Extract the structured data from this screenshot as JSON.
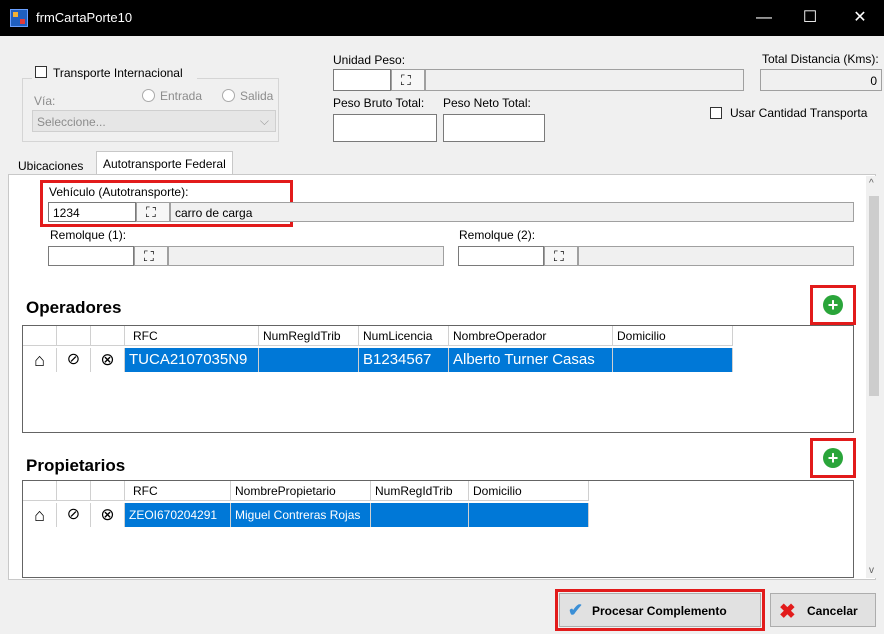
{
  "window": {
    "title": "frmCartaPorte10",
    "minimize": "—",
    "maximize": "☐",
    "close": "✕"
  },
  "top": {
    "transporte_internacional": "Transporte Internacional",
    "entrada": "Entrada",
    "salida": "Salida",
    "via_label": "Vía:",
    "via_value": "Seleccione...",
    "unidad_peso_label": "Unidad Peso:",
    "peso_bruto_label": "Peso Bruto Total:",
    "peso_neto_label": "Peso Neto Total:",
    "total_distancia_label": "Total Distancia (Kms):",
    "total_distancia_value": "0",
    "usar_cantidad": "Usar Cantidad Transporta"
  },
  "tabs": [
    "Ubicaciones",
    "Autotransporte Federal"
  ],
  "autotransporte": {
    "vehiculo_label": "Vehículo (Autotransporte):",
    "vehiculo_value": "1234",
    "vehiculo_desc": "carro de carga",
    "remolque1_label": "Remolque (1):",
    "remolque2_label": "Remolque (2):"
  },
  "operadores": {
    "title": "Operadores",
    "columns": [
      "RFC",
      "NumRegIdTrib",
      "NumLicencia",
      "NombreOperador",
      "Domicilio"
    ],
    "rows": [
      {
        "RFC": "TUCA2107035N9",
        "NumRegIdTrib": "",
        "NumLicencia": "B1234567",
        "NombreOperador": "Alberto Turner Casas",
        "Domicilio": ""
      }
    ]
  },
  "propietarios": {
    "title": "Propietarios",
    "columns": [
      "RFC",
      "NombrePropietario",
      "NumRegIdTrib",
      "Domicilio"
    ],
    "rows": [
      {
        "RFC": "ZEOI670204291",
        "NombrePropietario": "Miguel Contreras Rojas",
        "NumRegIdTrib": "",
        "Domicilio": ""
      }
    ]
  },
  "buttons": {
    "procesar": "Procesar Complemento",
    "cancelar": "Cancelar"
  },
  "colors": {
    "selection": "#0078d7",
    "highlight_box": "#e21b1b",
    "add_button": "#2aa53a"
  }
}
